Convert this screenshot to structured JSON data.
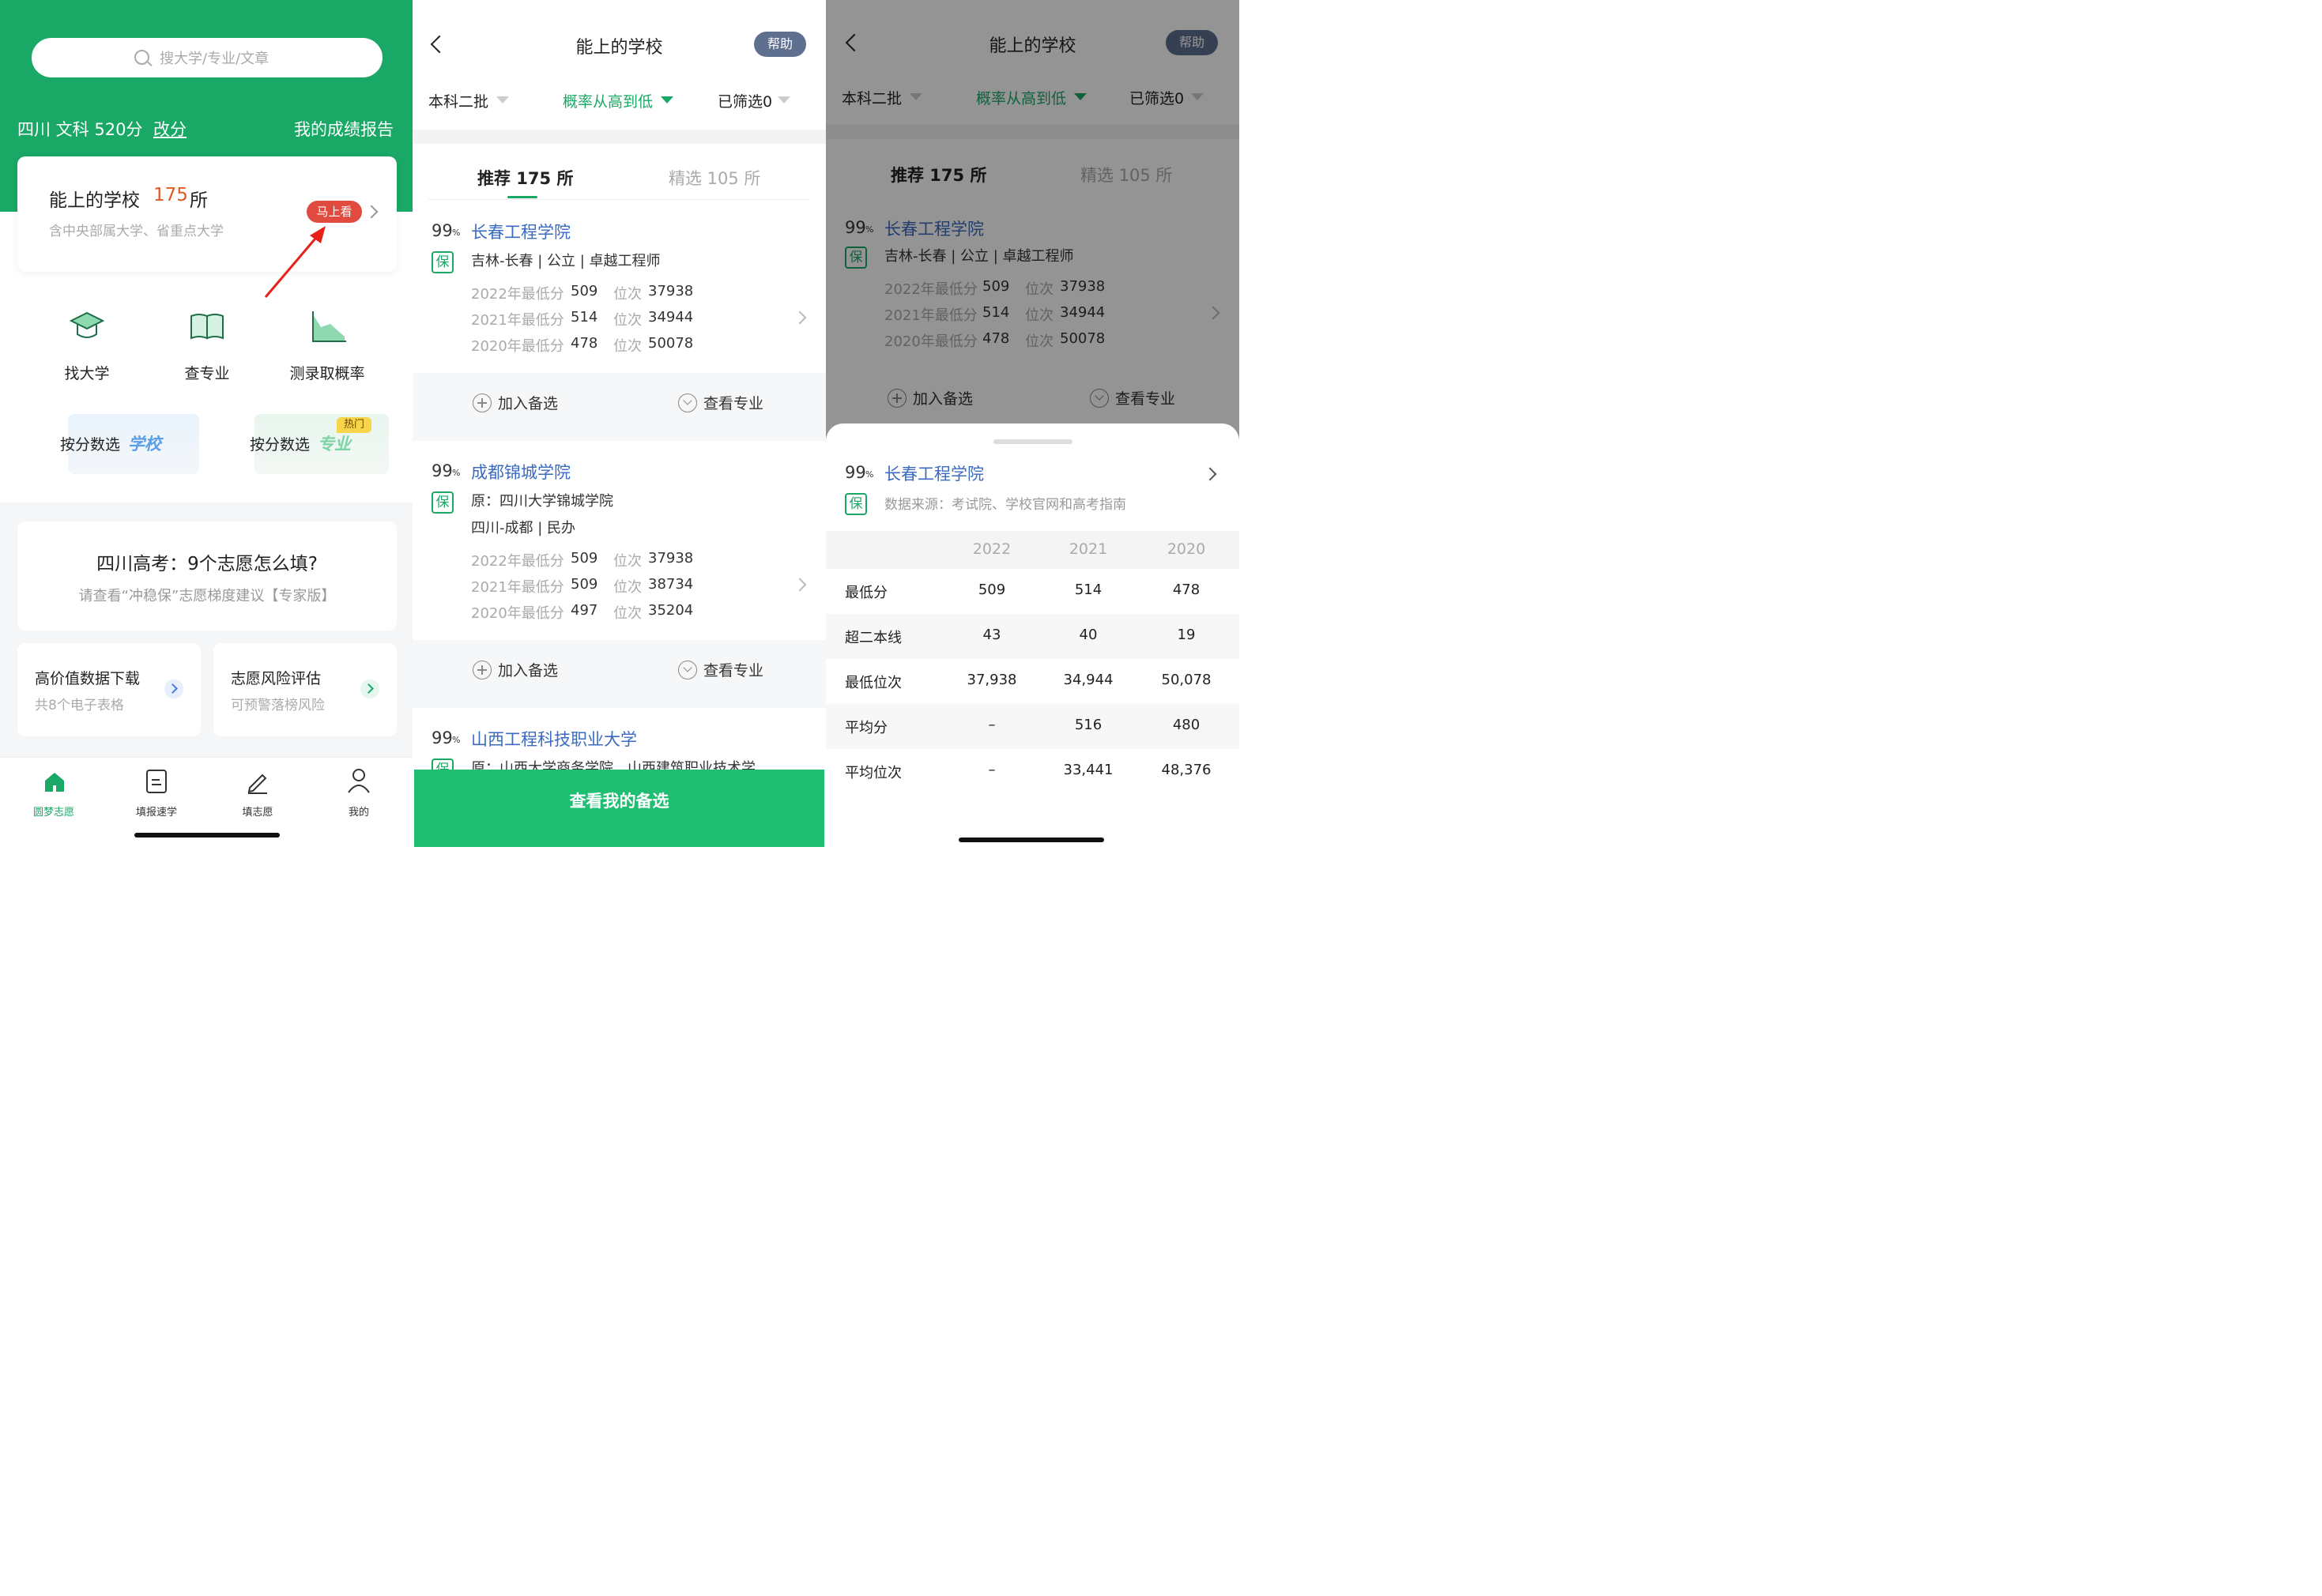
{
  "p1": {
    "search_placeholder": "搜大学/专业/文章",
    "score_line": "四川 文科 520分",
    "change_score": "改分",
    "my_report": "我的成绩报告",
    "card_title_pre": "能上的学校",
    "card_count": "175",
    "card_unit": "所",
    "card_sub": "含中央部属大学、省重点大学",
    "badge": "马上看",
    "tools": [
      {
        "label": "找大学",
        "icon": "graduation-cap-icon"
      },
      {
        "label": "查专业",
        "icon": "book-icon"
      },
      {
        "label": "测录取概率",
        "icon": "area-chart-icon"
      }
    ],
    "by_score_school": {
      "pre": "按分数选",
      "em": "学校"
    },
    "by_score_major": {
      "pre": "按分数选",
      "em": "专业",
      "hot": "热门"
    },
    "guide_title": "四川高考：9个志愿怎么填?",
    "guide_sub": "请查看“冲稳保”志愿梯度建议【专家版】",
    "feature_cards": [
      {
        "title": "高价值数据下载",
        "sub": "共8个电子表格"
      },
      {
        "title": "志愿风险评估",
        "sub": "可预警落榜风险"
      }
    ],
    "tabbar": [
      "圆梦志愿",
      "填报速学",
      "填志愿",
      "我的"
    ],
    "colors": {
      "brand": "#1aa866",
      "badge": "#e04a3f",
      "arrow": "#e8201a"
    }
  },
  "p2": {
    "title": "能上的学校",
    "help": "帮助",
    "filters": [
      "本科二批",
      "概率从高到低",
      "已筛选0"
    ],
    "tabs": [
      "推荐 175 所",
      "精选 105 所"
    ],
    "schools": [
      {
        "prob": "99",
        "pct": "%",
        "name": "长春工程学院",
        "bao": "保",
        "lines": [
          "吉林-长春 | 公立 | 卓越工程师"
        ],
        "stats": [
          {
            "year_label": "2022年最低分",
            "score": "509",
            "rank_label": "位次",
            "rank": "37938"
          },
          {
            "year_label": "2021年最低分",
            "score": "514",
            "rank_label": "位次",
            "rank": "34944"
          },
          {
            "year_label": "2020年最低分",
            "score": "478",
            "rank_label": "位次",
            "rank": "50078"
          }
        ],
        "add": "加入备选",
        "view": "查看专业"
      },
      {
        "prob": "99",
        "pct": "%",
        "name": "成都锦城学院",
        "bao": "保",
        "lines": [
          "原：四川大学锦城学院",
          "四川-成都 | 民办"
        ],
        "stats": [
          {
            "year_label": "2022年最低分",
            "score": "509",
            "rank_label": "位次",
            "rank": "37938"
          },
          {
            "year_label": "2021年最低分",
            "score": "509",
            "rank_label": "位次",
            "rank": "38734"
          },
          {
            "year_label": "2020年最低分",
            "score": "497",
            "rank_label": "位次",
            "rank": "35204"
          }
        ],
        "add": "加入备选",
        "view": "查看专业"
      },
      {
        "prob": "99",
        "pct": "%",
        "name": "山西工程科技职业大学",
        "bao": "保",
        "lines": [
          "原：山西大学商务学院、山西建筑职业技术学"
        ]
      }
    ],
    "bottom_button": "查看我的备选"
  },
  "p3": {
    "sheet_school": {
      "prob": "99",
      "pct": "%",
      "name": "长春工程学院",
      "bao": "保",
      "source": "数据来源：考试院、学校官网和高考指南"
    },
    "table": {
      "years": [
        "2022",
        "2021",
        "2020"
      ],
      "rows": [
        {
          "label": "最低分",
          "values": [
            "509",
            "514",
            "478"
          ]
        },
        {
          "label": "超二本线",
          "values": [
            "43",
            "40",
            "19"
          ]
        },
        {
          "label": "最低位次",
          "values": [
            "37,938",
            "34,944",
            "50,078"
          ]
        },
        {
          "label": "平均分",
          "values": [
            "–",
            "516",
            "480"
          ]
        },
        {
          "label": "平均位次",
          "values": [
            "–",
            "33,441",
            "48,376"
          ]
        }
      ]
    }
  }
}
